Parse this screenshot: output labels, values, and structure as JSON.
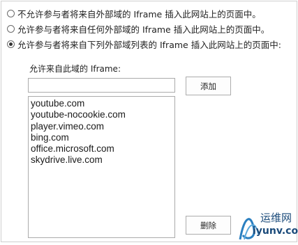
{
  "options": [
    {
      "label": "不允许参与者将来自外部域的 Iframe 插入此网站上的页面中。",
      "checked": false
    },
    {
      "label": "允许参与者将来自任何外部域的 Iframe 插入此网站上的页面中。",
      "checked": false
    },
    {
      "label": "允许参与者将来自下列外部域列表的 Iframe 插入此网站上的页面中:",
      "checked": true
    }
  ],
  "allow_label": "允许来自此域的 Iframe:",
  "domain_input": {
    "value": "",
    "placeholder": ""
  },
  "add_button": "添加",
  "delete_button": "删除",
  "domains": [
    "youtube.com",
    "youtube-nocookie.com",
    "player.vimeo.com",
    "bing.com",
    "office.microsoft.com",
    "skydrive.live.com"
  ],
  "watermark": {
    "name": "运维网",
    "url": "iyunv.com"
  }
}
